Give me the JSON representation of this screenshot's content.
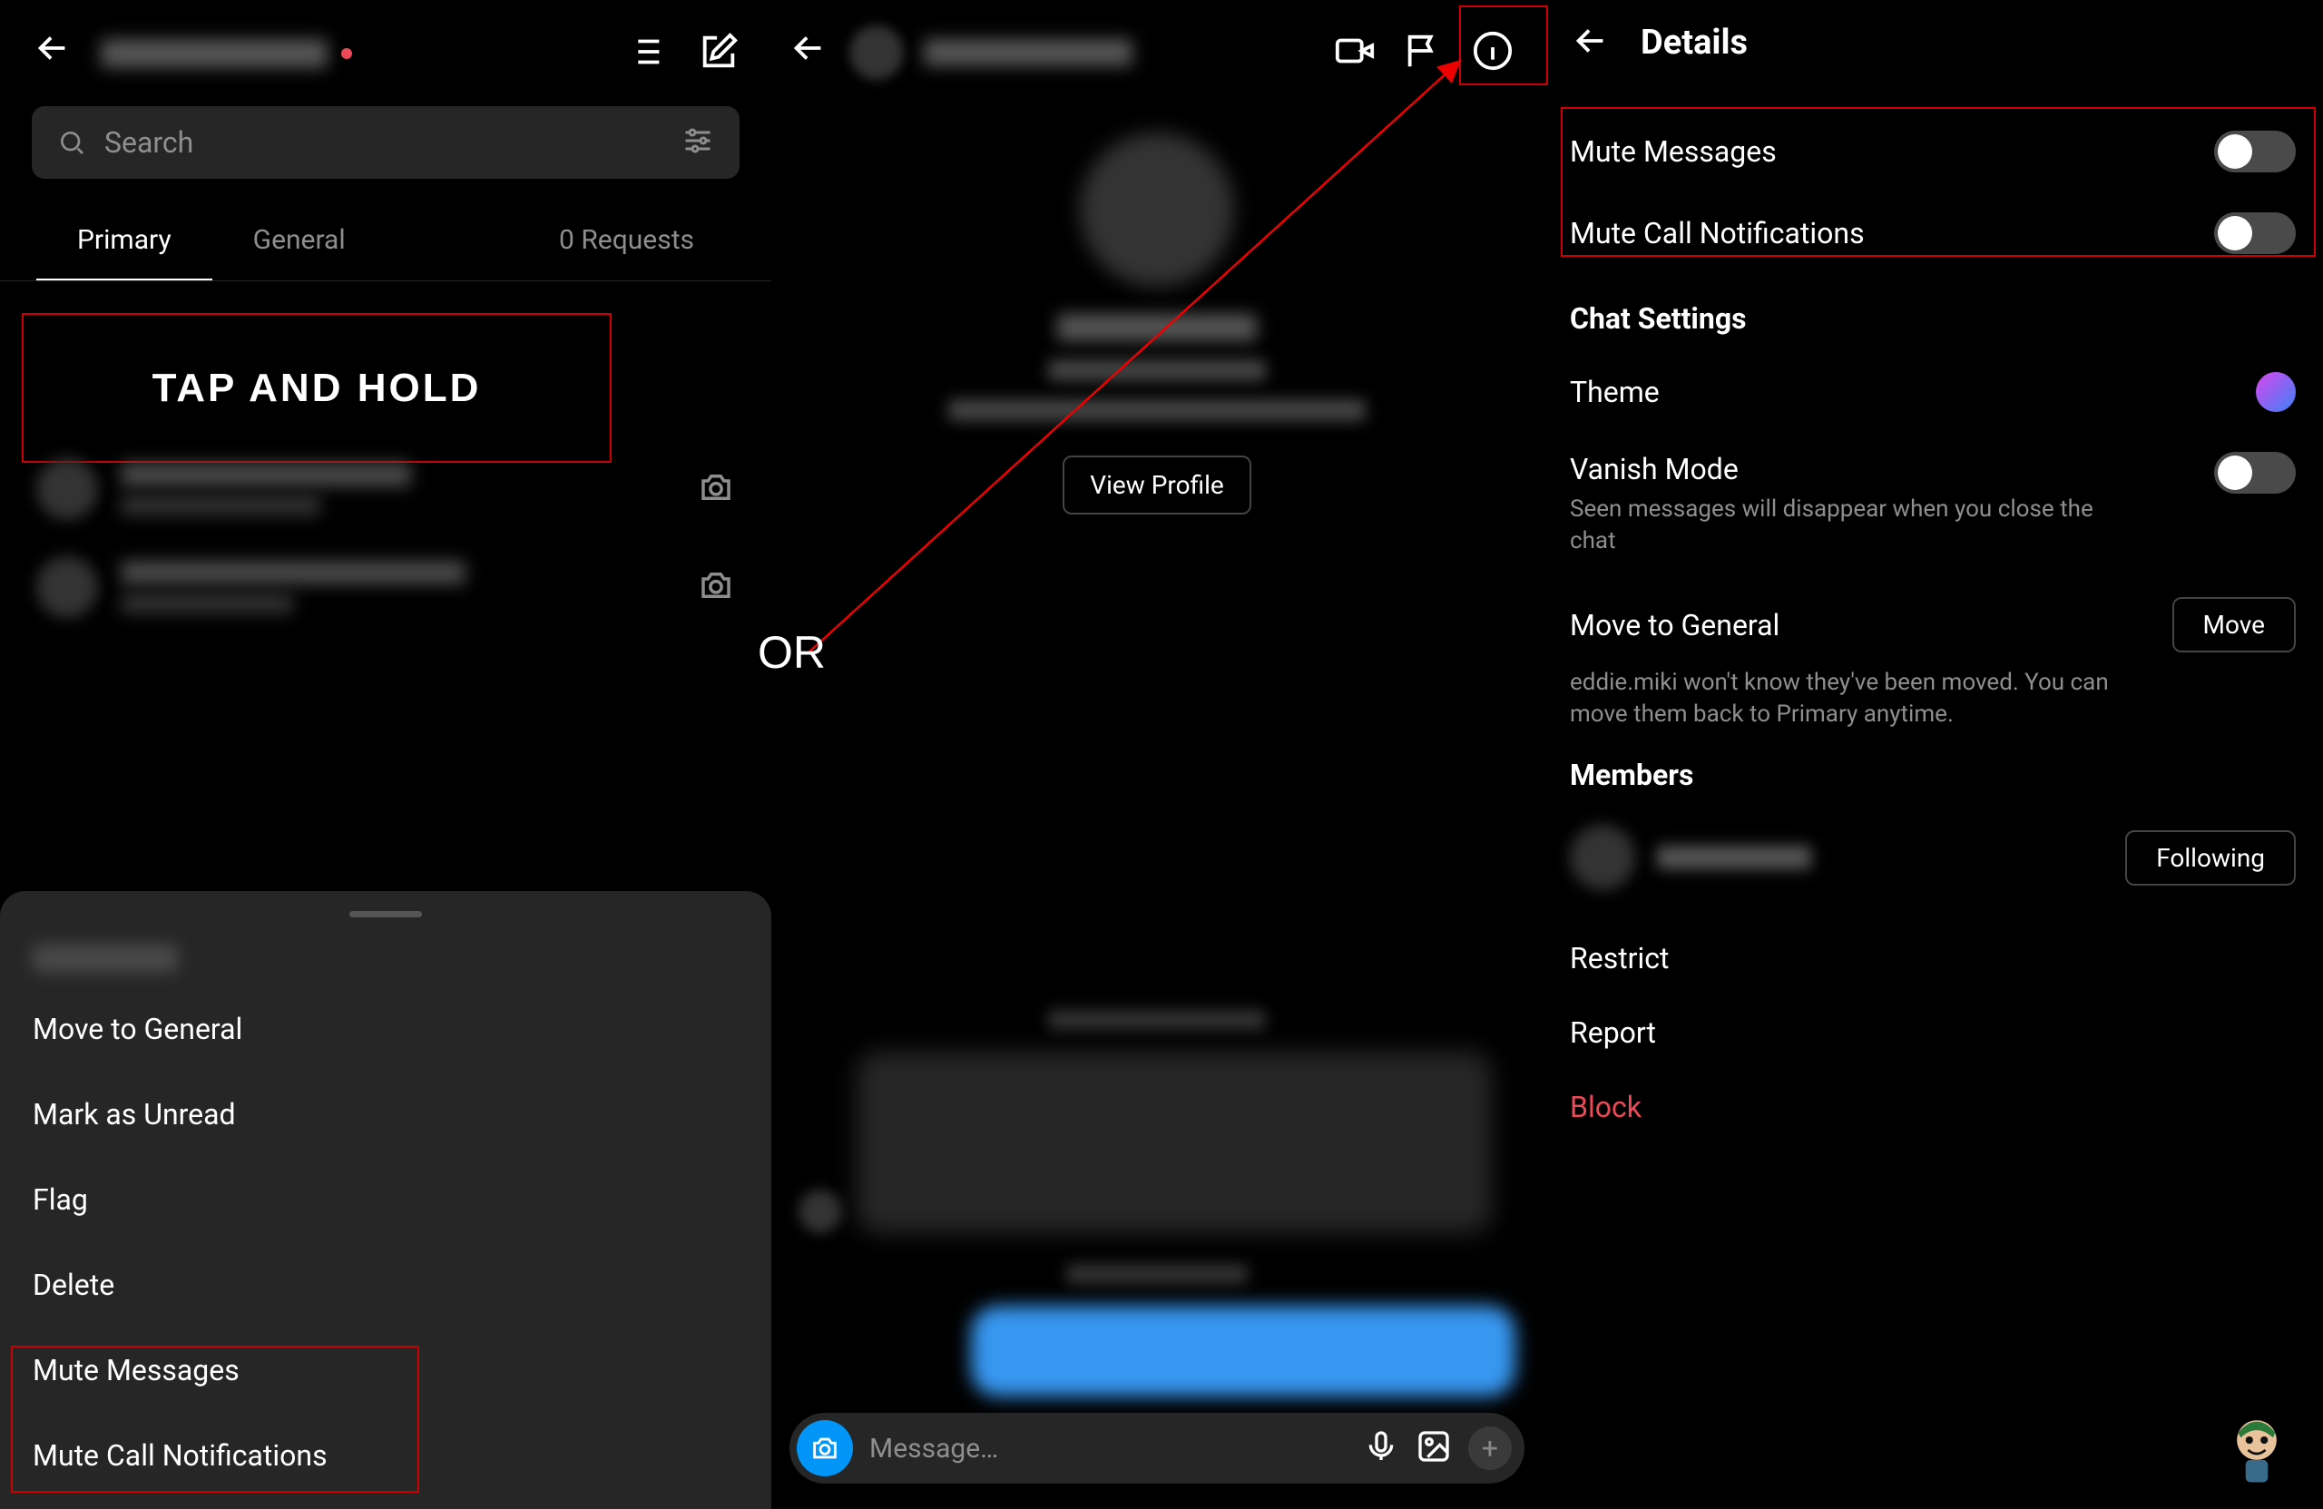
{
  "panel1": {
    "search_placeholder": "Search",
    "tabs": {
      "primary": "Primary",
      "general": "General",
      "requests": "0 Requests"
    },
    "tap_hold_label": "TAP AND HOLD",
    "sheet": {
      "move": "Move to General",
      "unread": "Mark as Unread",
      "flag": "Flag",
      "delete": "Delete",
      "mute_msg": "Mute Messages",
      "mute_call": "Mute Call Notifications"
    }
  },
  "or_label": "OR",
  "panel2": {
    "view_profile": "View Profile",
    "composer_placeholder": "Message…"
  },
  "panel3": {
    "title": "Details",
    "mute_messages": "Mute Messages",
    "mute_calls": "Mute Call Notifications",
    "chat_settings": "Chat Settings",
    "theme": "Theme",
    "vanish": "Vanish Mode",
    "vanish_sub": "Seen messages will disappear when you close the chat",
    "move_general": "Move to General",
    "move_btn": "Move",
    "move_sub": "eddie.miki won't know they've been moved. You can move them back to Primary anytime.",
    "members": "Members",
    "following": "Following",
    "restrict": "Restrict",
    "report": "Report",
    "block": "Block"
  }
}
